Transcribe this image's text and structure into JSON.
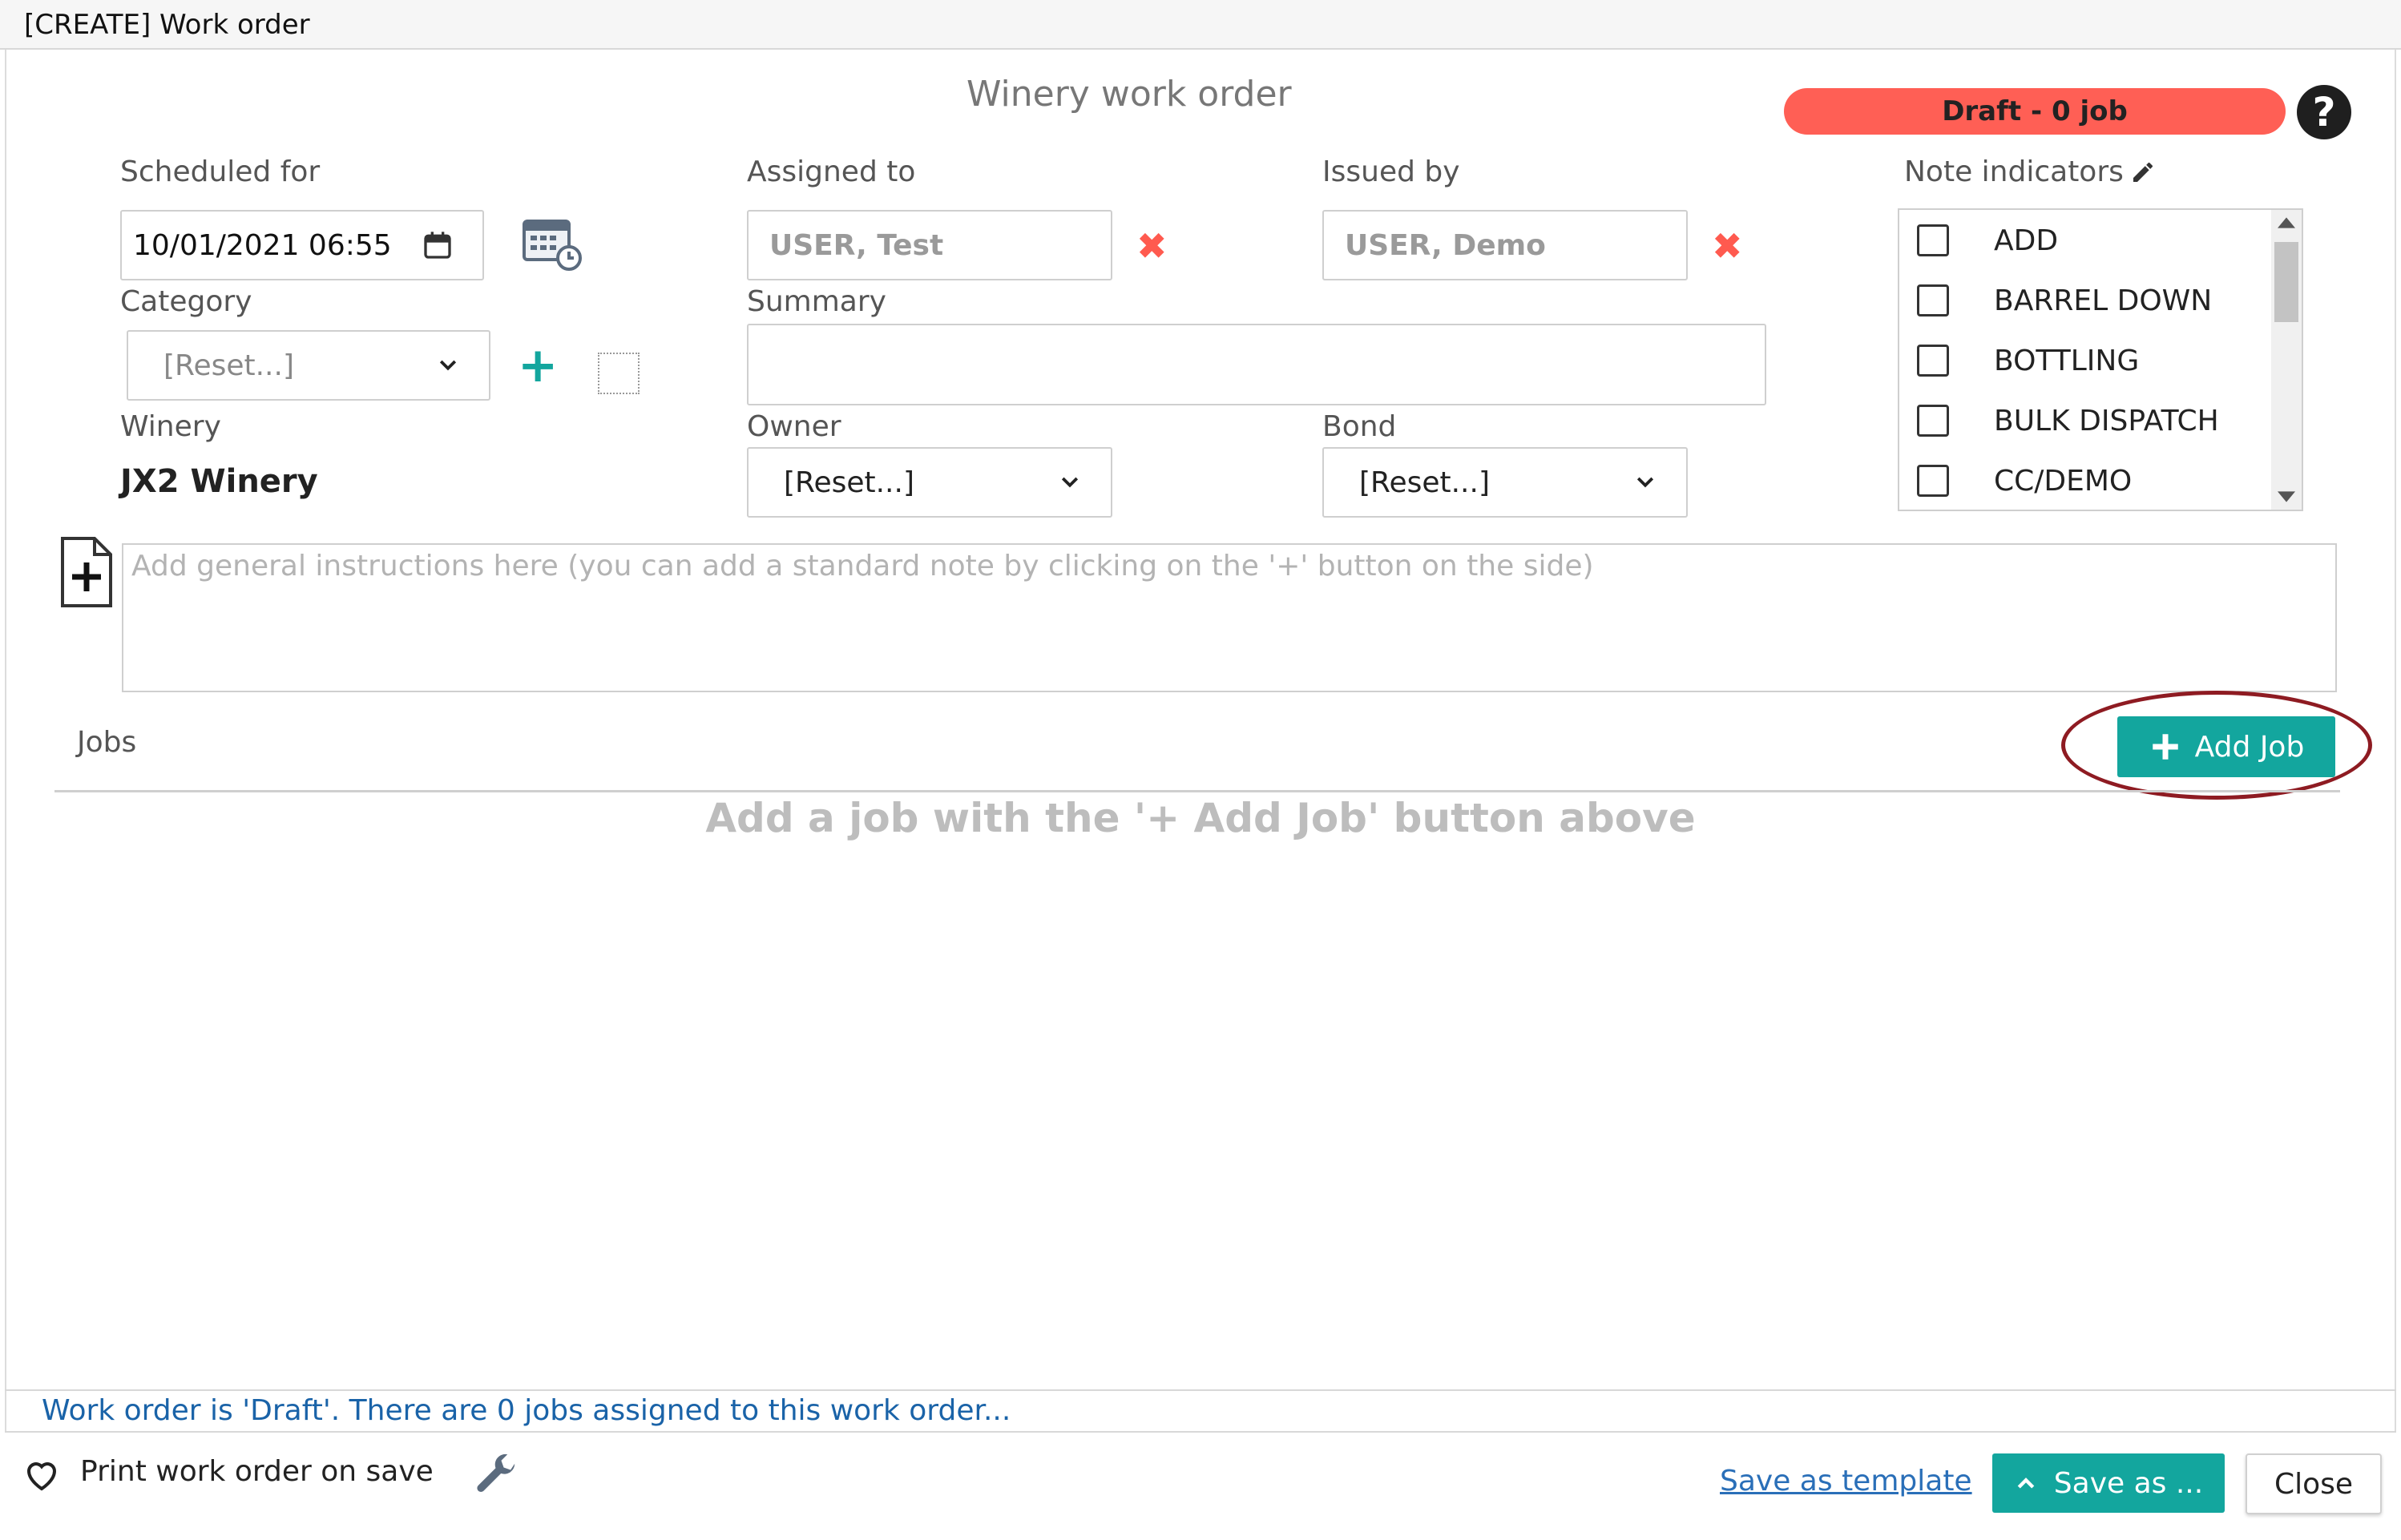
{
  "window": {
    "title": "[CREATE] Work order"
  },
  "header": {
    "form_title": "Winery work order",
    "status_badge": "Draft - 0 job",
    "help_glyph": "?"
  },
  "scheduled": {
    "label": "Scheduled for",
    "value": "10/01/2021 06:55"
  },
  "assigned": {
    "label": "Assigned to",
    "value": "USER, Test"
  },
  "issued": {
    "label": "Issued by",
    "value": "USER, Demo"
  },
  "notes": {
    "label": "Note indicators",
    "items": [
      "ADD",
      "BARREL DOWN",
      "BOTTLING",
      "BULK DISPATCH",
      "CC/DEMO"
    ]
  },
  "category": {
    "label": "Category",
    "value": "[Reset...]"
  },
  "summary": {
    "label": "Summary",
    "value": ""
  },
  "winery": {
    "label": "Winery",
    "value": "JX2 Winery"
  },
  "owner": {
    "label": "Owner",
    "value": "[Reset...]"
  },
  "bond": {
    "label": "Bond",
    "value": "[Reset...]"
  },
  "instructions": {
    "placeholder": "Add general instructions here (you can add a standard note by clicking on the '+' button on the side)"
  },
  "jobs": {
    "label": "Jobs",
    "add_button": "Add Job",
    "empty_message": "Add a job with the '+ Add Job' button above"
  },
  "status_line": "Work order is 'Draft'. There are 0 jobs assigned to this work order...",
  "footer": {
    "print_label": "Print work order on save",
    "save_template": "Save as template",
    "save_as": "Save as ...",
    "close": "Close"
  },
  "colors": {
    "accent": "#13a69e",
    "draft": "#ff5f55",
    "danger": "#ff5a4f",
    "link": "#2a6fb8"
  }
}
